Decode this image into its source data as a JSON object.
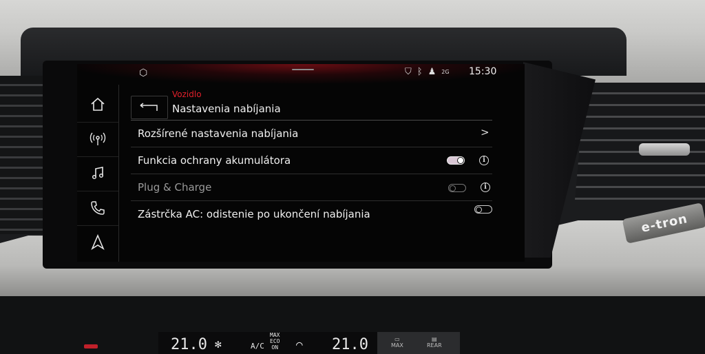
{
  "status_bar": {
    "time": "15:30",
    "network_label": "2G",
    "icons": [
      "vehicle-cube-icon",
      "location-icon",
      "bluetooth-icon",
      "person-icon",
      "signal-icon"
    ]
  },
  "sidebar": {
    "items": [
      {
        "name": "home",
        "icon": "home-icon"
      },
      {
        "name": "radio",
        "icon": "radio-icon"
      },
      {
        "name": "media",
        "icon": "music-note-icon"
      },
      {
        "name": "phone",
        "icon": "phone-icon"
      },
      {
        "name": "navigation",
        "icon": "navigation-arrow-icon"
      }
    ]
  },
  "header": {
    "breadcrumb": "Vozidlo",
    "title": "Nastavenia nabíjania",
    "back_icon": "back-arrow-icon"
  },
  "settings": [
    {
      "label": "Rozšírené nastavenia nabíjania",
      "control": "chevron",
      "chevron": ">"
    },
    {
      "label": "Funkcia ochrany akumulátora",
      "control": "toggle",
      "state": "on",
      "info": "i"
    },
    {
      "label": "Plug & Charge",
      "control": "toggle",
      "state": "off",
      "enabled": false,
      "info": "i"
    },
    {
      "label": "Zástrčka AC: odistenie po ukončení nabíjania",
      "control": "toggle",
      "state": "off"
    }
  ],
  "car": {
    "badge": "e-tron",
    "climate": {
      "left_temp": "21.0",
      "right_temp": "21.0",
      "ac_label": "A/C",
      "max_label": "MAX",
      "eco_label": "ECO",
      "on_label": "ON",
      "rear_label": "REAR",
      "max2_label": "MAX"
    }
  },
  "colors": {
    "accent_red": "#e3202b",
    "text": "#f0f0f0",
    "background": "#050505"
  }
}
